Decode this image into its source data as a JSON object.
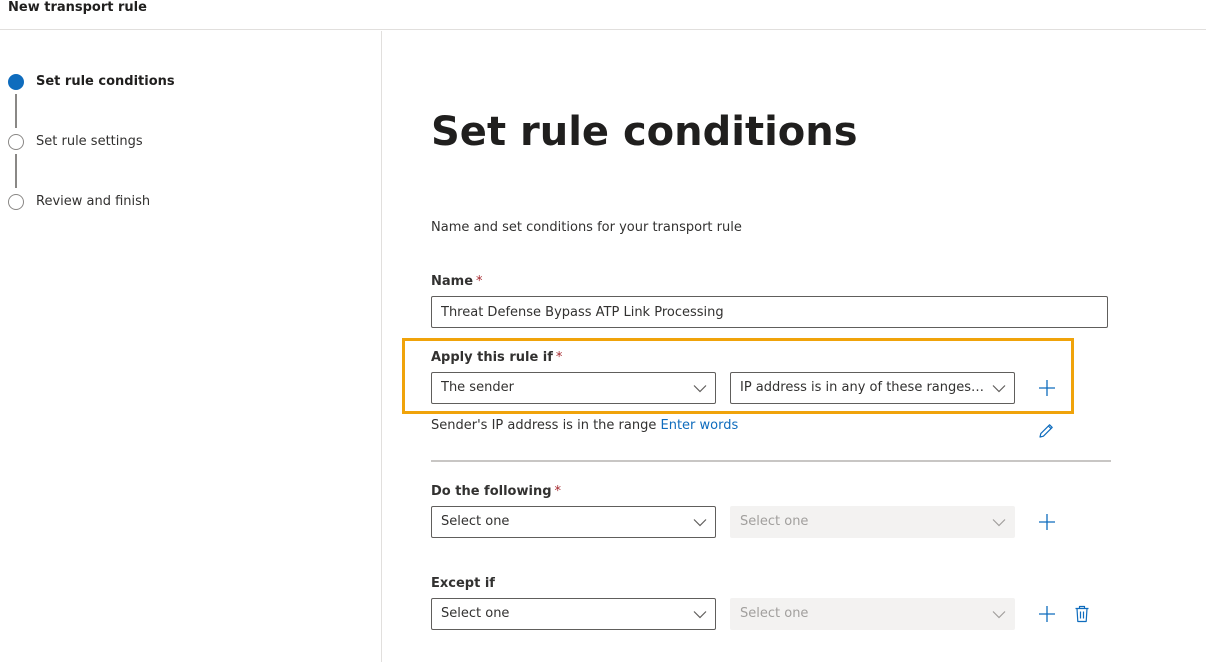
{
  "window": {
    "title": "New transport rule"
  },
  "steps": [
    {
      "label": "Set rule conditions",
      "state": "current"
    },
    {
      "label": "Set rule settings",
      "state": "upcoming"
    },
    {
      "label": "Review and finish",
      "state": "upcoming"
    }
  ],
  "main": {
    "title": "Set rule conditions",
    "description": "Name and set conditions for your transport rule"
  },
  "name_field": {
    "label": "Name",
    "required_mark": "*",
    "value": "Threat Defense Bypass ATP Link Processing"
  },
  "apply_if": {
    "label": "Apply this rule if",
    "required_mark": "*",
    "primary": "The sender",
    "secondary": "IP address is in any of these ranges or...",
    "summary_text": "Sender's IP address is in the range",
    "summary_link": "Enter words"
  },
  "do_following": {
    "label": "Do the following",
    "required_mark": "*",
    "primary": "Select one",
    "secondary": "Select one"
  },
  "except_if": {
    "label": "Except if",
    "primary": "Select one",
    "secondary": "Select one"
  },
  "icons": {
    "add": "plus-icon",
    "edit": "pencil-icon",
    "delete": "trash-icon",
    "expand": "chevron-down-icon"
  },
  "colors": {
    "accent": "#0f6cbd",
    "highlight": "#f0a30a",
    "required": "#a4262c"
  }
}
